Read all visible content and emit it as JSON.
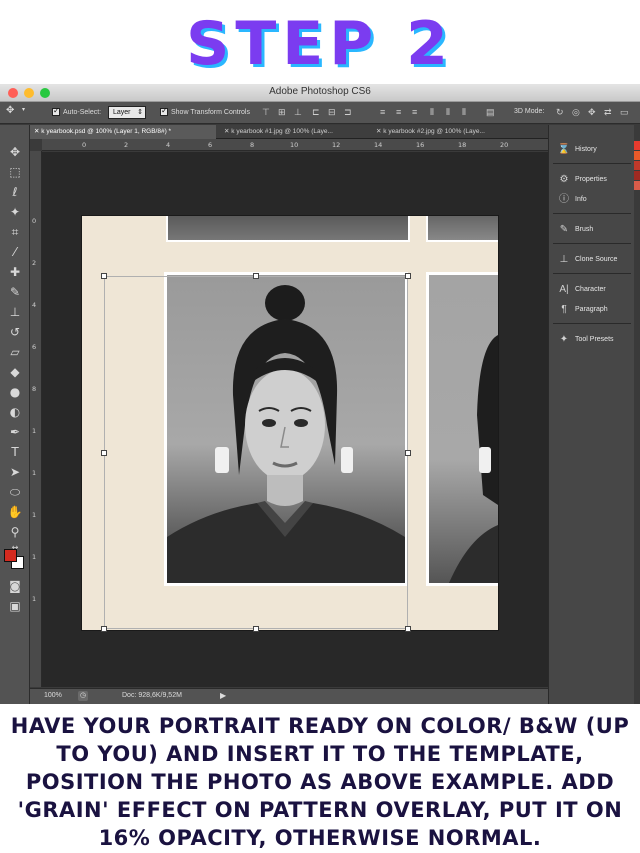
{
  "title": "STEP 2",
  "app": {
    "window_title": "Adobe Photoshop CS6"
  },
  "options_bar": {
    "auto_select_label": "Auto-Select:",
    "auto_select_value": "Layer",
    "show_transform_label": "Show Transform Controls",
    "mode_3d_label": "3D Mode:"
  },
  "tabs": [
    {
      "label": "k yearbook.psd @ 100% (Layer 1, RGB/8#) *"
    },
    {
      "label": "k yearbook #1.jpg @ 100% (Laye..."
    },
    {
      "label": "k yearbook #2.jpg @ 100% (Laye..."
    }
  ],
  "ruler": {
    "top_ticks": [
      "0",
      "2",
      "4",
      "6",
      "8",
      "10",
      "12",
      "14",
      "16",
      "18",
      "20"
    ],
    "left_ticks": [
      "0",
      "2",
      "4",
      "6",
      "8",
      "1",
      "1",
      "1",
      "1",
      "1"
    ]
  },
  "status": {
    "zoom": "100%",
    "doc": "Doc: 928,6K/9,52M"
  },
  "panels": [
    {
      "label": "History",
      "icon": "history-icon"
    },
    {
      "label": "Properties",
      "icon": "properties-icon"
    },
    {
      "label": "Info",
      "icon": "info-icon"
    },
    {
      "label": "Brush",
      "icon": "brush-icon"
    },
    {
      "label": "Clone Source",
      "icon": "clone-source-icon"
    },
    {
      "label": "Character",
      "icon": "character-icon"
    },
    {
      "label": "Paragraph",
      "icon": "paragraph-icon"
    },
    {
      "label": "Tool Presets",
      "icon": "tool-presets-icon"
    }
  ],
  "colors": {
    "foreground": "#d42a1f",
    "background": "#ffffff",
    "title_purple": "#7b3cf0",
    "title_shadow": "#2ab7ff"
  },
  "caption": "HAVE YOUR PORTRAIT READY ON COLOR/ B&W (UP TO YOU) AND INSERT IT TO THE TEMPLATE, POSITION THE PHOTO AS ABOVE EXAMPLE. ADD 'GRAIN' EFFECT ON PATTERN OVERLAY, PUT IT ON 16% OPACITY, OTHERWISE NORMAL."
}
